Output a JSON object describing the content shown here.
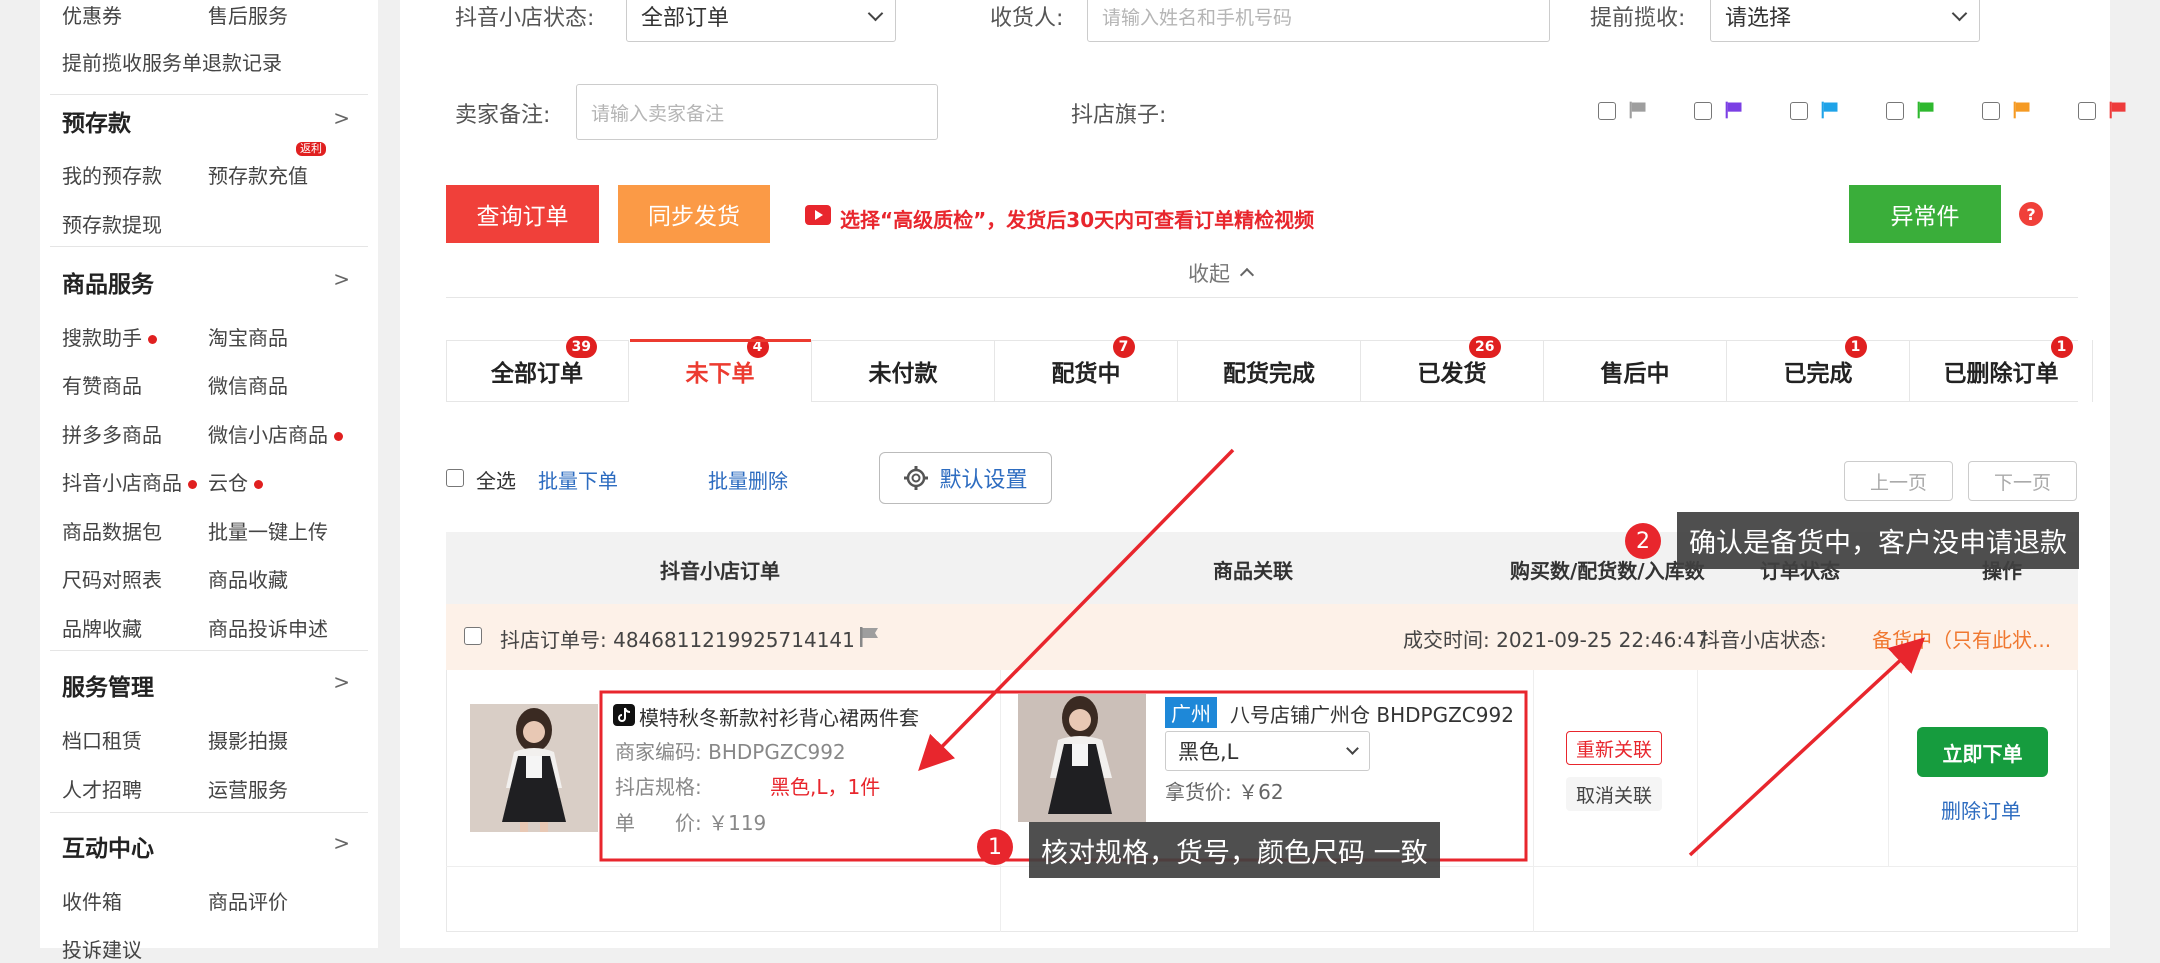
{
  "sidebar": {
    "row0": [
      "优惠券",
      "售后服务"
    ],
    "refund_link": "提前揽收服务单退款记录",
    "sec_prepay": "预存款",
    "prepay_links": [
      "我的预存款",
      "预存款充值",
      "预存款提现"
    ],
    "prepay_badge": "返利",
    "sec_goods": "商品服务",
    "goods_links": [
      "搜款助手",
      "淘宝商品",
      "有赞商品",
      "微信商品",
      "拼多多商品",
      "微信小店商品",
      "抖音小店商品",
      "云仓",
      "商品数据包",
      "批量一键上传",
      "尺码对照表",
      "商品收藏",
      "品牌收藏",
      "商品投诉申述"
    ],
    "sec_service": "服务管理",
    "service_links": [
      "档口租赁",
      "摄影拍摄",
      "人才招聘",
      "运营服务"
    ],
    "sec_interact": "互动中心",
    "interact_links": [
      "收件箱",
      "商品评价",
      "投诉建议"
    ],
    "arrow": ">"
  },
  "filters": {
    "store_status_label": "抖音小店状态:",
    "store_status_value": "全部订单",
    "receiver_label": "收货人:",
    "receiver_placeholder": "请输入姓名和手机号码",
    "pickup_label": "提前揽收:",
    "pickup_value": "请选择",
    "remark_label": "卖家备注:",
    "remark_placeholder": "请输入卖家备注",
    "flag_label": "抖店旗子:",
    "flag_colors": [
      "#9e9e9e",
      "#7b3fe4",
      "#1fa3e8",
      "#2eb82e",
      "#f59a23",
      "#ee3b3b"
    ]
  },
  "actions": {
    "query": "查询订单",
    "sync_ship": "同步发货",
    "promo": "选择“高级质检”，发货后30天内可查看订单精检视频",
    "exception": "异常件",
    "collapse": "收起"
  },
  "tabs": [
    {
      "label": "全部订单",
      "badge": "39"
    },
    {
      "label": "未下单",
      "badge": "4"
    },
    {
      "label": "未付款",
      "badge": ""
    },
    {
      "label": "配货中",
      "badge": "7"
    },
    {
      "label": "配货完成",
      "badge": ""
    },
    {
      "label": "已发货",
      "badge": "26"
    },
    {
      "label": "售后中",
      "badge": ""
    },
    {
      "label": "已完成",
      "badge": "1"
    },
    {
      "label": "已删除订单",
      "badge": "1"
    }
  ],
  "toolbar": {
    "select_all": "全选",
    "batch_order": "批量下单",
    "batch_delete": "批量删除",
    "default_settings": "默认设置",
    "prev": "上一页",
    "next": "下一页"
  },
  "table": {
    "headers": [
      "抖音小店订单",
      "商品关联",
      "购买数/配货数/入库数",
      "订单状态",
      "操作"
    ],
    "order": {
      "order_no": "抖店订单号: 4846811219925714141",
      "deal_time": "成交时间: 2021-09-25 22:46:47",
      "status_label": "抖音小店状态:",
      "status_value": "备货中（只有此状..."
    },
    "item": {
      "title": "模特秋冬新款衬衫背心裙两件套",
      "merchant_code": "商家编码: BHDPGZC992",
      "spec_label": "抖店规格:",
      "spec_value": "黑色,L，1件",
      "price": "单　　价: ￥119"
    },
    "linked": {
      "city": "广州",
      "shop": "八号店铺广州仓 BHDPGZC992",
      "variant": "黑色,L",
      "price": "拿货价: ￥62"
    },
    "relink": "重新关联",
    "unlink": "取消关联",
    "place_order": "立即下单",
    "delete_order": "删除订单"
  },
  "annotations": {
    "one": "核对规格，货号，颜色尺码 一致",
    "two": "确认是备货中，客户没申请退款",
    "n1": "1",
    "n2": "2"
  }
}
